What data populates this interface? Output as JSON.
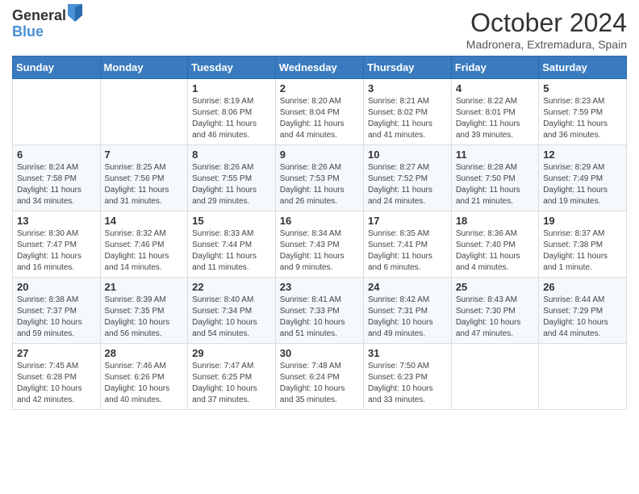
{
  "header": {
    "logo_general": "General",
    "logo_blue": "Blue",
    "month_title": "October 2024",
    "subtitle": "Madronera, Extremadura, Spain"
  },
  "days_of_week": [
    "Sunday",
    "Monday",
    "Tuesday",
    "Wednesday",
    "Thursday",
    "Friday",
    "Saturday"
  ],
  "weeks": [
    [
      {
        "day": "",
        "info": ""
      },
      {
        "day": "",
        "info": ""
      },
      {
        "day": "1",
        "info": "Sunrise: 8:19 AM\nSunset: 8:06 PM\nDaylight: 11 hours and 46 minutes."
      },
      {
        "day": "2",
        "info": "Sunrise: 8:20 AM\nSunset: 8:04 PM\nDaylight: 11 hours and 44 minutes."
      },
      {
        "day": "3",
        "info": "Sunrise: 8:21 AM\nSunset: 8:02 PM\nDaylight: 11 hours and 41 minutes."
      },
      {
        "day": "4",
        "info": "Sunrise: 8:22 AM\nSunset: 8:01 PM\nDaylight: 11 hours and 39 minutes."
      },
      {
        "day": "5",
        "info": "Sunrise: 8:23 AM\nSunset: 7:59 PM\nDaylight: 11 hours and 36 minutes."
      }
    ],
    [
      {
        "day": "6",
        "info": "Sunrise: 8:24 AM\nSunset: 7:58 PM\nDaylight: 11 hours and 34 minutes."
      },
      {
        "day": "7",
        "info": "Sunrise: 8:25 AM\nSunset: 7:56 PM\nDaylight: 11 hours and 31 minutes."
      },
      {
        "day": "8",
        "info": "Sunrise: 8:26 AM\nSunset: 7:55 PM\nDaylight: 11 hours and 29 minutes."
      },
      {
        "day": "9",
        "info": "Sunrise: 8:26 AM\nSunset: 7:53 PM\nDaylight: 11 hours and 26 minutes."
      },
      {
        "day": "10",
        "info": "Sunrise: 8:27 AM\nSunset: 7:52 PM\nDaylight: 11 hours and 24 minutes."
      },
      {
        "day": "11",
        "info": "Sunrise: 8:28 AM\nSunset: 7:50 PM\nDaylight: 11 hours and 21 minutes."
      },
      {
        "day": "12",
        "info": "Sunrise: 8:29 AM\nSunset: 7:49 PM\nDaylight: 11 hours and 19 minutes."
      }
    ],
    [
      {
        "day": "13",
        "info": "Sunrise: 8:30 AM\nSunset: 7:47 PM\nDaylight: 11 hours and 16 minutes."
      },
      {
        "day": "14",
        "info": "Sunrise: 8:32 AM\nSunset: 7:46 PM\nDaylight: 11 hours and 14 minutes."
      },
      {
        "day": "15",
        "info": "Sunrise: 8:33 AM\nSunset: 7:44 PM\nDaylight: 11 hours and 11 minutes."
      },
      {
        "day": "16",
        "info": "Sunrise: 8:34 AM\nSunset: 7:43 PM\nDaylight: 11 hours and 9 minutes."
      },
      {
        "day": "17",
        "info": "Sunrise: 8:35 AM\nSunset: 7:41 PM\nDaylight: 11 hours and 6 minutes."
      },
      {
        "day": "18",
        "info": "Sunrise: 8:36 AM\nSunset: 7:40 PM\nDaylight: 11 hours and 4 minutes."
      },
      {
        "day": "19",
        "info": "Sunrise: 8:37 AM\nSunset: 7:38 PM\nDaylight: 11 hours and 1 minute."
      }
    ],
    [
      {
        "day": "20",
        "info": "Sunrise: 8:38 AM\nSunset: 7:37 PM\nDaylight: 10 hours and 59 minutes."
      },
      {
        "day": "21",
        "info": "Sunrise: 8:39 AM\nSunset: 7:35 PM\nDaylight: 10 hours and 56 minutes."
      },
      {
        "day": "22",
        "info": "Sunrise: 8:40 AM\nSunset: 7:34 PM\nDaylight: 10 hours and 54 minutes."
      },
      {
        "day": "23",
        "info": "Sunrise: 8:41 AM\nSunset: 7:33 PM\nDaylight: 10 hours and 51 minutes."
      },
      {
        "day": "24",
        "info": "Sunrise: 8:42 AM\nSunset: 7:31 PM\nDaylight: 10 hours and 49 minutes."
      },
      {
        "day": "25",
        "info": "Sunrise: 8:43 AM\nSunset: 7:30 PM\nDaylight: 10 hours and 47 minutes."
      },
      {
        "day": "26",
        "info": "Sunrise: 8:44 AM\nSunset: 7:29 PM\nDaylight: 10 hours and 44 minutes."
      }
    ],
    [
      {
        "day": "27",
        "info": "Sunrise: 7:45 AM\nSunset: 6:28 PM\nDaylight: 10 hours and 42 minutes."
      },
      {
        "day": "28",
        "info": "Sunrise: 7:46 AM\nSunset: 6:26 PM\nDaylight: 10 hours and 40 minutes."
      },
      {
        "day": "29",
        "info": "Sunrise: 7:47 AM\nSunset: 6:25 PM\nDaylight: 10 hours and 37 minutes."
      },
      {
        "day": "30",
        "info": "Sunrise: 7:48 AM\nSunset: 6:24 PM\nDaylight: 10 hours and 35 minutes."
      },
      {
        "day": "31",
        "info": "Sunrise: 7:50 AM\nSunset: 6:23 PM\nDaylight: 10 hours and 33 minutes."
      },
      {
        "day": "",
        "info": ""
      },
      {
        "day": "",
        "info": ""
      }
    ]
  ]
}
